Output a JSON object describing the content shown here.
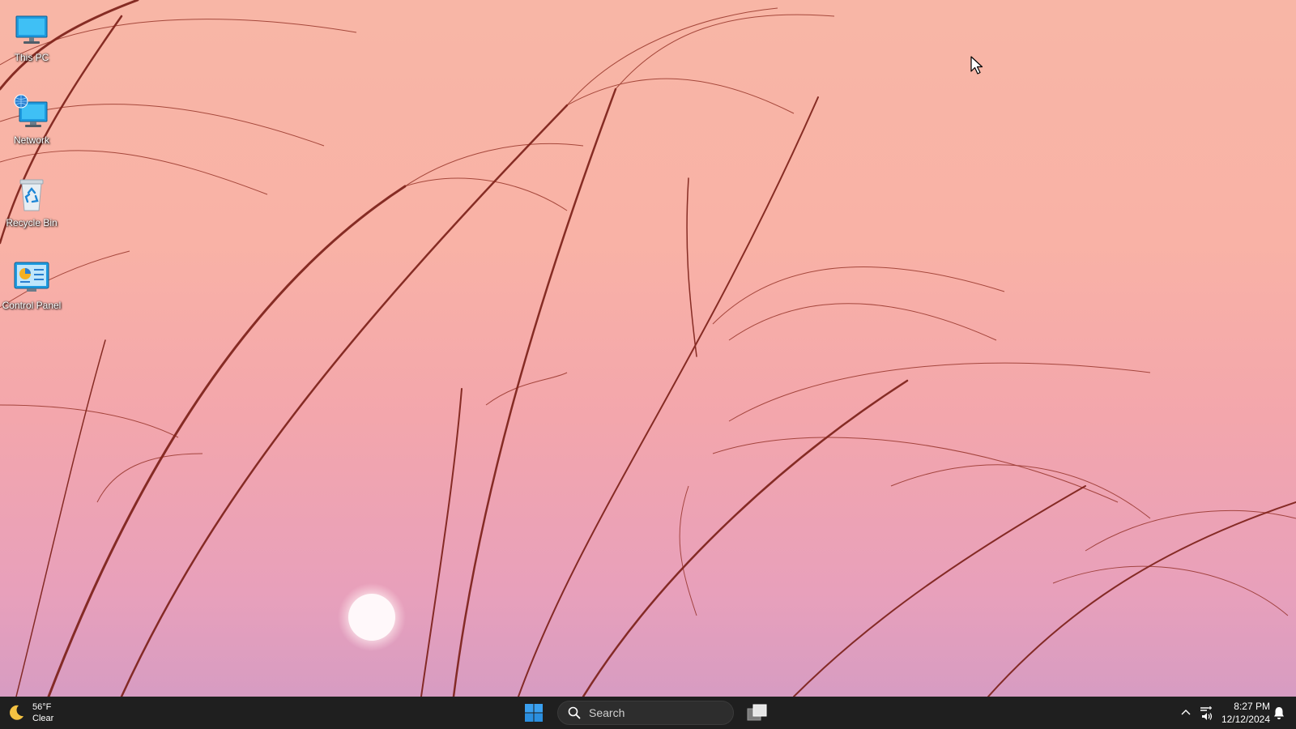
{
  "desktop": {
    "icons": [
      {
        "label": "This PC",
        "icon": "monitor-icon"
      },
      {
        "label": "Network",
        "icon": "network-icon"
      },
      {
        "label": "Recycle Bin",
        "icon": "recycle-bin-icon"
      },
      {
        "label": "Control Panel",
        "icon": "control-panel-icon"
      }
    ]
  },
  "taskbar": {
    "weather": {
      "temp": "56°F",
      "condition": "Clear",
      "icon": "moon-icon"
    },
    "start_icon": "windows-logo-icon",
    "search": {
      "placeholder": "Search",
      "icon": "search-icon"
    },
    "task_view_icon": "task-view-icon",
    "tray": {
      "time": "8:27 PM",
      "date": "12/12/2024",
      "icons": [
        "chevron-up-icon",
        "network-icon",
        "volume-icon",
        "bell-icon"
      ]
    }
  },
  "colors": {
    "taskbar_bg": "#1f1f1f",
    "wallpaper_top": "#f8b6a6",
    "wallpaper_bottom": "#d79cc2",
    "grass": "#8a2418",
    "accent_blue": "#0078d4"
  }
}
